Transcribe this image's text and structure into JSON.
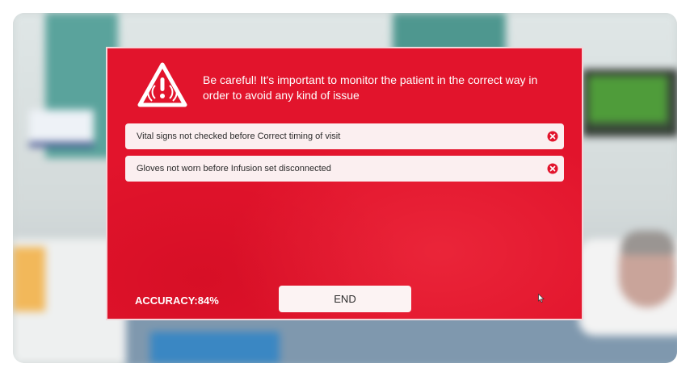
{
  "modal": {
    "message": "Be careful! It's important to monitor the patient in the correct way in order to avoid any kind of issue",
    "warning_icon": "warning-triangle-icon",
    "errors": [
      {
        "text": "Vital signs not checked before Correct timing of visit",
        "icon": "close-circle-icon"
      },
      {
        "text": "Gloves not worn before Infusion set disconnected",
        "icon": "close-circle-icon"
      }
    ],
    "accuracy_label": "ACCURACY:84%",
    "end_button_label": "END"
  },
  "colors": {
    "modal_background": "#e2142c",
    "row_background": "#fbeff0",
    "close_icon": "#e2142c"
  }
}
